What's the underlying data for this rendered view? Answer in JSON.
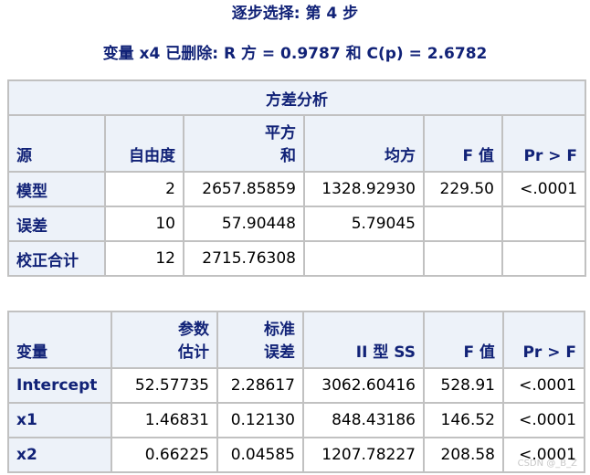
{
  "title_step": "逐步选择: 第 4 步",
  "title_removed": "变量 x4 已删除: R 方 = 0.9787 和 C(p) = 2.6782",
  "anova": {
    "caption": "方差分析",
    "headers": {
      "source": "源",
      "df": "自由度",
      "ss_line1": "平方",
      "ss_line2": "和",
      "ms": "均方",
      "f": "F 值",
      "p": "Pr > F"
    },
    "rows": [
      {
        "source": "模型",
        "df": "2",
        "ss": "2657.85859",
        "ms": "1328.92930",
        "f": "229.50",
        "p": "<.0001"
      },
      {
        "source": "误差",
        "df": "10",
        "ss": "57.90448",
        "ms": "5.79045",
        "f": "",
        "p": ""
      },
      {
        "source": "校正合计",
        "df": "12",
        "ss": "2715.76308",
        "ms": "",
        "f": "",
        "p": ""
      }
    ]
  },
  "params": {
    "headers": {
      "variable": "变量",
      "est_line1": "参数",
      "est_line2": "估计",
      "se_line1": "标准",
      "se_line2": "误差",
      "type2ss": "II 型 SS",
      "f": "F 值",
      "p": "Pr > F"
    },
    "rows": [
      {
        "variable": "Intercept",
        "est": "52.57735",
        "se": "2.28617",
        "ss": "3062.60416",
        "f": "528.91",
        "p": "<.0001"
      },
      {
        "variable": "x1",
        "est": "1.46831",
        "se": "0.12130",
        "ss": "848.43186",
        "f": "146.52",
        "p": "<.0001"
      },
      {
        "variable": "x2",
        "est": "0.66225",
        "se": "0.04585",
        "ss": "1207.78227",
        "f": "208.58",
        "p": "<.0001"
      }
    ]
  },
  "watermark": "CSDN @_B_Z"
}
